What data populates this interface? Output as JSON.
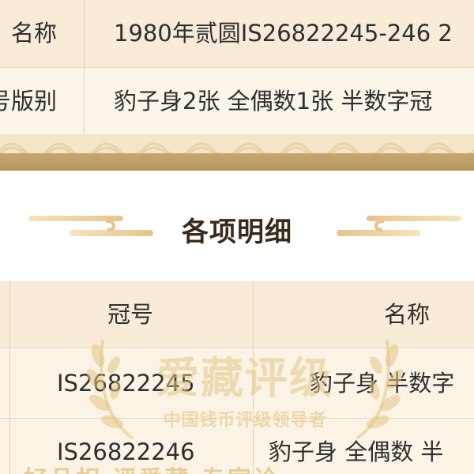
{
  "summary": {
    "rows": [
      {
        "label": "名称",
        "value": "1980年贰圆IS26822245-246 2"
      },
      {
        "label": "号版别",
        "value": "豹子身2张 全偶数1张 半数字冠"
      }
    ]
  },
  "section": {
    "title": "各项明细"
  },
  "details": {
    "headers": {
      "serial": "冠号",
      "name": "名称"
    },
    "rows": [
      {
        "serial": "IS26822245",
        "name": "豹子身 半数字"
      },
      {
        "serial": "IS26822246",
        "name": "豹子身 全偶数 半"
      }
    ]
  },
  "watermark": {
    "title": "爱藏评级",
    "subtitle": "中国钱币评级领导者",
    "slogan": "好品相 评爱藏 专家论"
  },
  "colors": {
    "gold": "#b8945c",
    "cream": "#fbf4e6",
    "watermark": "#e2c482"
  },
  "icons": [
    "cloud-ornament-icon",
    "laurel-icon"
  ]
}
